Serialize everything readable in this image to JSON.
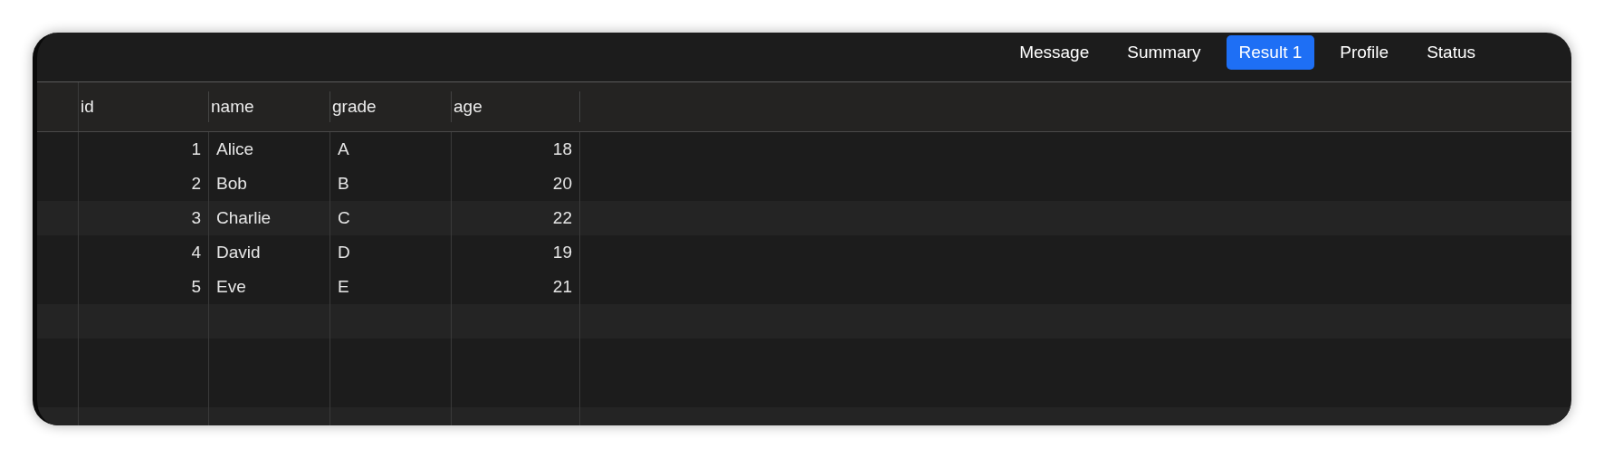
{
  "tabs": [
    {
      "label": "Message",
      "selected": false
    },
    {
      "label": "Summary",
      "selected": false
    },
    {
      "label": "Result 1",
      "selected": true
    },
    {
      "label": "Profile",
      "selected": false
    },
    {
      "label": "Status",
      "selected": false
    }
  ],
  "table": {
    "columns": [
      {
        "label": "id",
        "kind": "number"
      },
      {
        "label": "name",
        "kind": "text"
      },
      {
        "label": "grade",
        "kind": "text"
      },
      {
        "label": "age",
        "kind": "number"
      }
    ],
    "rows": [
      [
        "1",
        "Alice",
        "A",
        "18"
      ],
      [
        "2",
        "Bob",
        "B",
        "20"
      ],
      [
        "3",
        "Charlie",
        "C",
        "22"
      ],
      [
        "4",
        "David",
        "D",
        "19"
      ],
      [
        "5",
        "Eve",
        "E",
        "21"
      ]
    ]
  }
}
